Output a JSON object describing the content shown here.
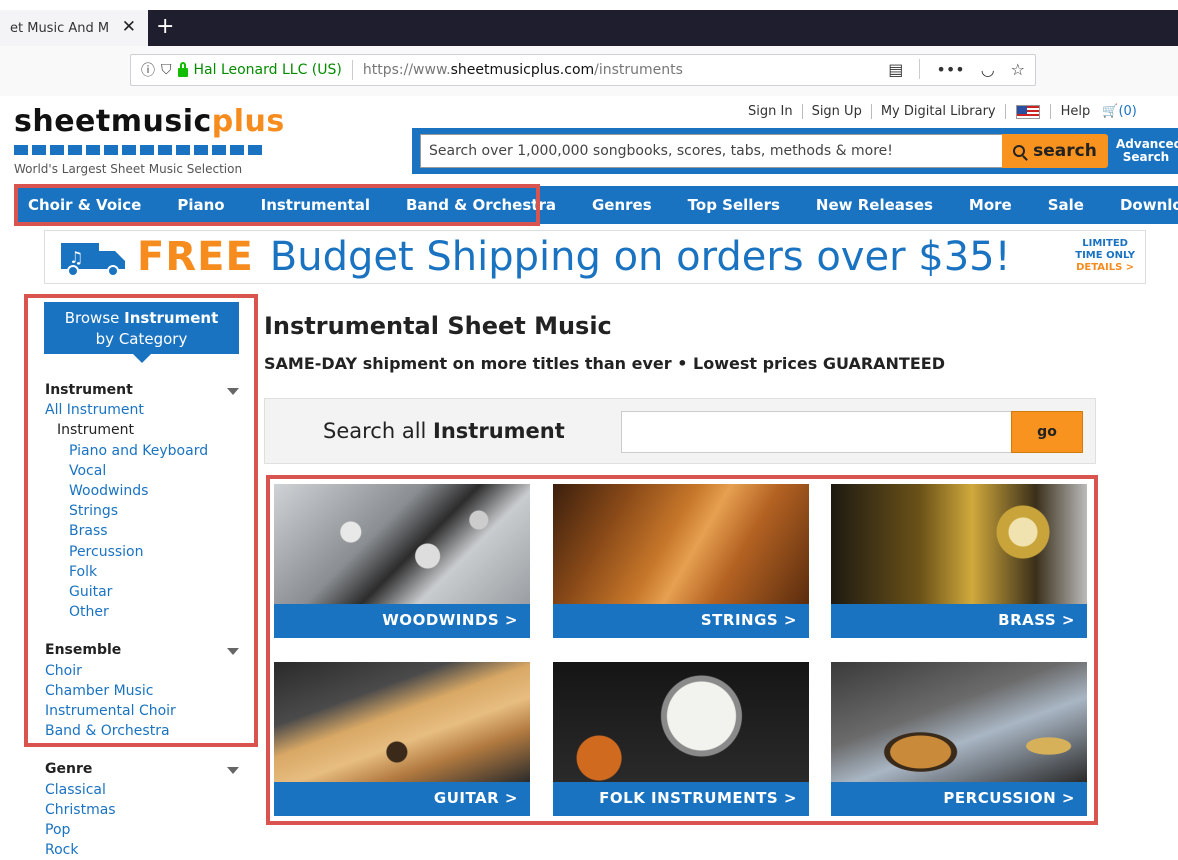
{
  "browser": {
    "tab_title": "et Music And M",
    "close_glyph": "✕",
    "new_tab_glyph": "+",
    "org_name": "Hal Leonard LLC (US)",
    "url_prefix": "https://www.",
    "url_domain": "sheetmusicplus.com",
    "url_path": "/instruments"
  },
  "site": {
    "logo_main": "sheetmusic",
    "logo_plus": "plus",
    "tagline": "World's Largest Sheet Music Selection",
    "top_links": [
      "Sign In",
      "Sign Up",
      "My Digital Library"
    ],
    "help": "Help",
    "cart_count": "(0)",
    "search_placeholder": "Search over 1,000,000 songbooks, scores, tabs, methods & more!",
    "search_button": "search",
    "advanced_1": "Advanced",
    "advanced_2": "Search"
  },
  "nav": [
    "Choir & Voice",
    "Piano",
    "Instrumental",
    "Band & Orchestra",
    "Genres",
    "Top Sellers",
    "New Releases",
    "More",
    "Sale",
    "Download"
  ],
  "banner": {
    "free": "FREE",
    "rest": "Budget Shipping on orders over $35!",
    "limited_1": "LIMITED",
    "limited_2": "TIME ONLY",
    "details": "DETAILS >"
  },
  "sidebar": {
    "browse_1a": "Browse",
    "browse_1b": "Instrument",
    "browse_2": "by Category",
    "instrument_header": "Instrument",
    "all_instrument": "All Instrument",
    "instrument_sub": "Instrument",
    "instrument_items": [
      "Piano and Keyboard",
      "Vocal",
      "Woodwinds",
      "Strings",
      "Brass",
      "Percussion",
      "Folk",
      "Guitar",
      "Other"
    ],
    "ensemble_header": "Ensemble",
    "ensemble_items": [
      "Choir",
      "Chamber Music",
      "Instrumental Choir",
      "Band & Orchestra"
    ],
    "genre_header": "Genre",
    "genre_items": [
      "Classical",
      "Christmas",
      "Pop",
      "Rock"
    ]
  },
  "main": {
    "title": "Instrumental Sheet Music",
    "subtitle": "SAME-DAY shipment on more titles than ever • Lowest prices GUARANTEED",
    "search_all_prefix": "Search all",
    "search_all_bold": "Instrument",
    "go": "go",
    "tiles": [
      "WOODWINDS >",
      "STRINGS >",
      "BRASS >",
      "GUITAR >",
      "FOLK INSTRUMENTS >",
      "PERCUSSION >"
    ]
  },
  "colors": {
    "brand_blue": "#1a73c1",
    "orange": "#f7931e",
    "highlight_red": "#d9534f"
  }
}
